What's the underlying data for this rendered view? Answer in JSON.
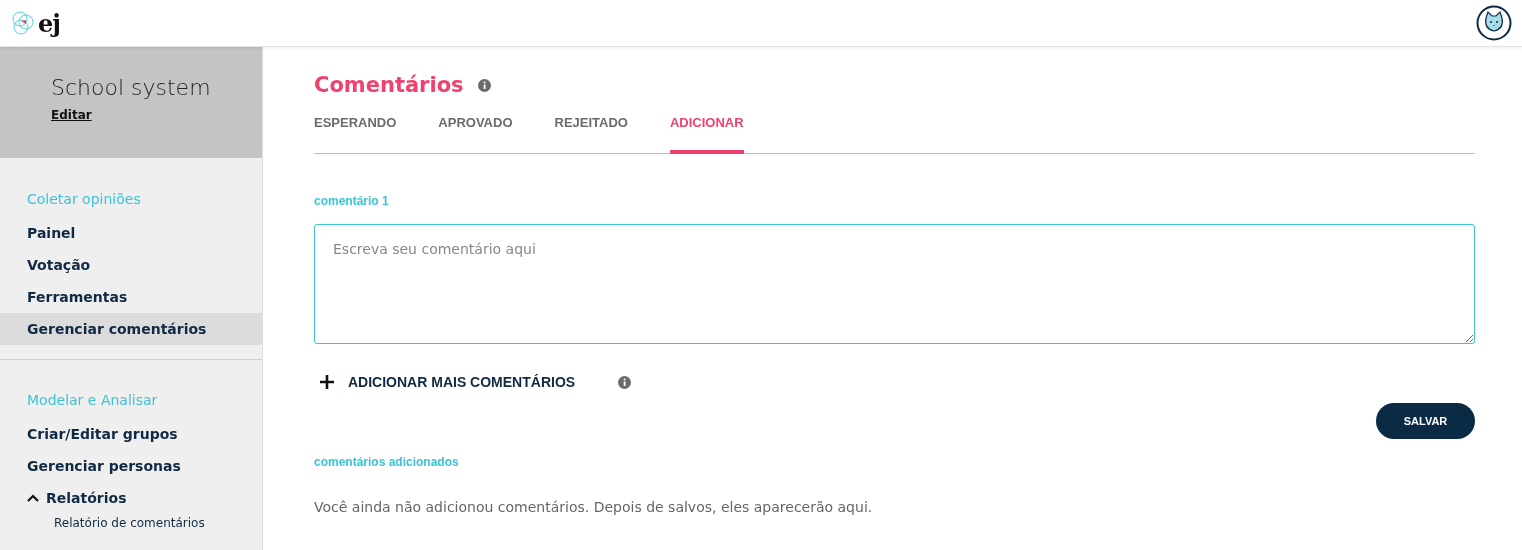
{
  "logo": {
    "text": "ej"
  },
  "sidebar": {
    "title": "School system",
    "edit_link": "Editar",
    "sections": [
      {
        "heading": "Coletar opiniões",
        "items": [
          {
            "label": "Painel",
            "selected": false
          },
          {
            "label": "Votação",
            "selected": false
          },
          {
            "label": "Ferramentas",
            "selected": false
          },
          {
            "label": "Gerenciar comentários",
            "selected": true
          }
        ]
      },
      {
        "heading": "Modelar e Analisar",
        "items": [
          {
            "label": "Criar/Editar grupos",
            "selected": false
          },
          {
            "label": "Gerenciar personas",
            "selected": false
          },
          {
            "label": "Relatórios",
            "selected": false,
            "expanded": true,
            "children": [
              {
                "label": "Relatório de comentários",
                "selected": false
              }
            ]
          }
        ]
      }
    ]
  },
  "main": {
    "title": "Comentários",
    "tabs": [
      {
        "label": "ESPERANDO",
        "selected": false
      },
      {
        "label": "APROVADO",
        "selected": false
      },
      {
        "label": "REJEITADO",
        "selected": false
      },
      {
        "label": "ADICIONAR",
        "selected": true
      }
    ],
    "comment_label": "comentário 1",
    "comment_field": {
      "placeholder": "Escreva seu comentário aqui"
    },
    "add_more": "ADICIONAR MAIS COMENTÁRIOS",
    "save_button": "SALVAR",
    "added_heading": "comentários adicionados",
    "empty_message": "Você ainda não adicionou comentários. Depois de salvos, eles aparecerão aqui."
  }
}
